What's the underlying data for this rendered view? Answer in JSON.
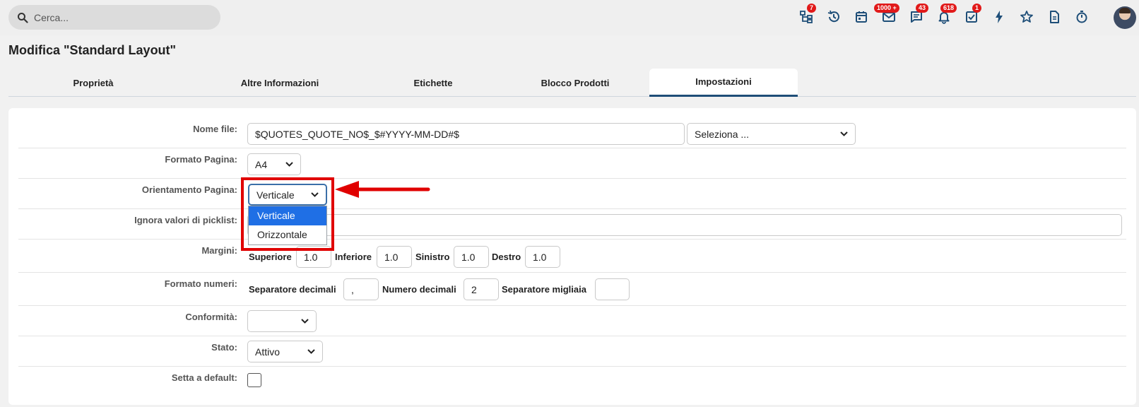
{
  "search": {
    "placeholder": "Cerca..."
  },
  "topbar": {
    "icons": [
      {
        "name": "hierarchy-icon",
        "badge": "7"
      },
      {
        "name": "history-icon",
        "badge": ""
      },
      {
        "name": "calendar-icon",
        "badge": ""
      },
      {
        "name": "mail-icon",
        "badge": "1000 +"
      },
      {
        "name": "chat-icon",
        "badge": "43"
      },
      {
        "name": "bell-icon",
        "badge": "618"
      },
      {
        "name": "task-check-icon",
        "badge": "1"
      },
      {
        "name": "lightning-icon",
        "badge": ""
      },
      {
        "name": "star-icon",
        "badge": ""
      },
      {
        "name": "document-icon",
        "badge": ""
      },
      {
        "name": "stopwatch-icon",
        "badge": ""
      }
    ],
    "badge_color": "#e11919",
    "icon_color": "#1e4e78"
  },
  "page": {
    "title": "Modifica \"Standard Layout\""
  },
  "tabs": [
    {
      "label": "Proprietà",
      "active": false
    },
    {
      "label": "Altre Informazioni",
      "active": false
    },
    {
      "label": "Etichette",
      "active": false
    },
    {
      "label": "Blocco Prodotti",
      "active": false
    },
    {
      "label": "Impostazioni",
      "active": true
    }
  ],
  "form": {
    "nome_file": {
      "label": "Nome file:",
      "value": "$QUOTES_QUOTE_NO$_$#YYYY-MM-DD#$",
      "select": "Seleziona ..."
    },
    "formato_pagina": {
      "label": "Formato Pagina:",
      "value": "A4"
    },
    "orientamento": {
      "label": "Orientamento Pagina:",
      "value": "Verticale",
      "options": [
        "Verticale",
        "Orizzontale"
      ]
    },
    "ignora": {
      "label": "Ignora valori di picklist:",
      "value": ""
    },
    "margini": {
      "label": "Margini:",
      "superiore_label": "Superiore",
      "superiore": "1.0",
      "inferiore_label": "Inferiore",
      "inferiore": "1.0",
      "sinistro_label": "Sinistro",
      "sinistro": "1.0",
      "destro_label": "Destro",
      "destro": "1.0"
    },
    "formato_numeri": {
      "label": "Formato numeri:",
      "sep_decimali_label": "Separatore decimali",
      "sep_decimali": ",",
      "num_decimali_label": "Numero decimali",
      "num_decimali": "2",
      "sep_migliaia_label": "Separatore migliaia",
      "sep_migliaia": ""
    },
    "conformita": {
      "label": "Conformità:",
      "value": ""
    },
    "stato": {
      "label": "Stato:",
      "value": "Attivo"
    },
    "default": {
      "label": "Setta a default:",
      "checked": false
    }
  },
  "annotation_color": "#e00000"
}
